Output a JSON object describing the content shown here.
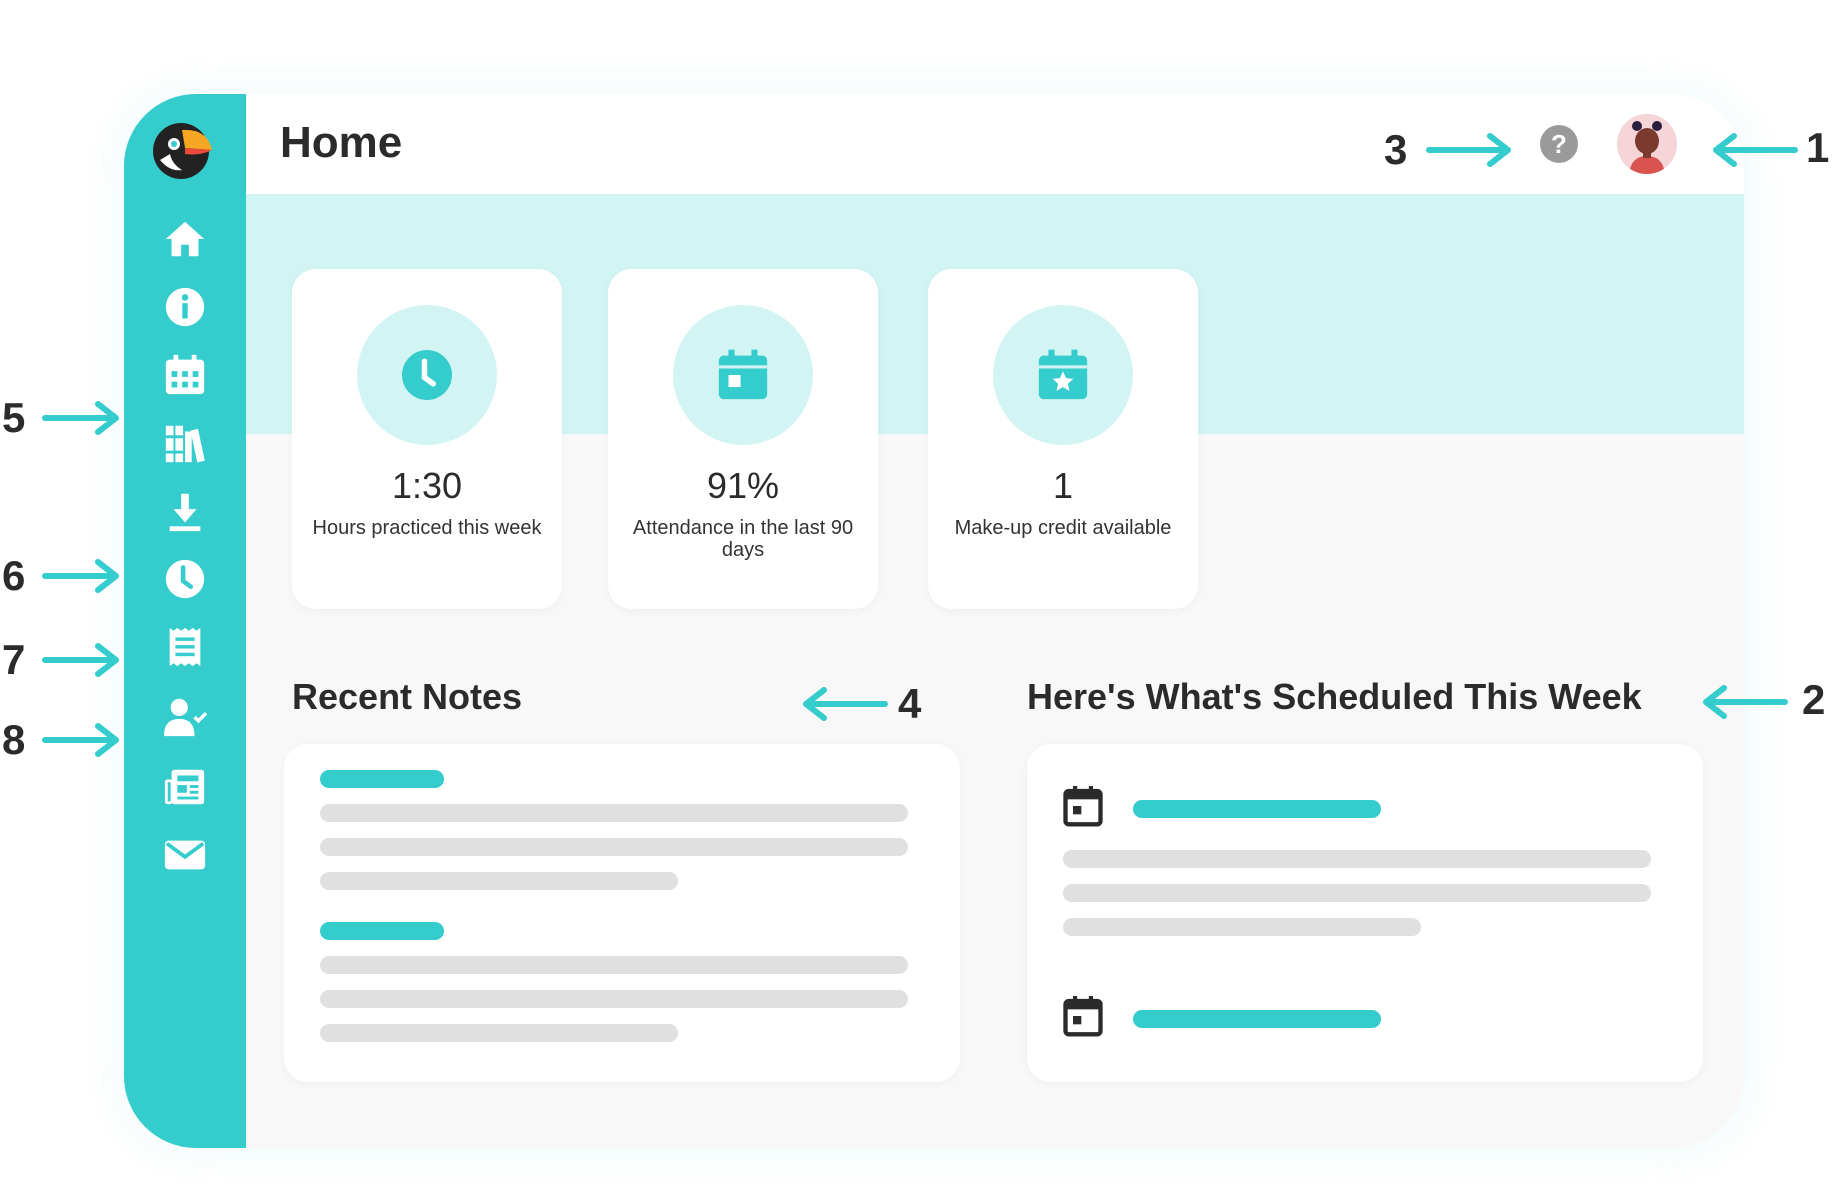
{
  "header": {
    "title": "Home",
    "help_glyph": "?"
  },
  "sidebar": {
    "logo": "toucan-logo",
    "items": [
      {
        "icon": "home-icon"
      },
      {
        "icon": "info-icon"
      },
      {
        "icon": "calendar-icon"
      },
      {
        "icon": "library-icon"
      },
      {
        "icon": "download-icon"
      },
      {
        "icon": "clock-icon"
      },
      {
        "icon": "receipt-icon"
      },
      {
        "icon": "user-check-icon"
      },
      {
        "icon": "newspaper-icon"
      },
      {
        "icon": "mail-icon"
      }
    ]
  },
  "stats": [
    {
      "value": "1:30",
      "label": "Hours practiced this week",
      "icon": "clock-icon"
    },
    {
      "value": "91%",
      "label": "Attendance in the last 90 days",
      "icon": "calendar-icon"
    },
    {
      "value": "1",
      "label": "Make-up credit available",
      "icon": "calendar-star-icon"
    }
  ],
  "sections": {
    "notes_title": "Recent Notes",
    "schedule_title": "Here's What's Scheduled This Week"
  },
  "annotations": [
    "1",
    "2",
    "3",
    "4",
    "5",
    "6",
    "7",
    "8"
  ],
  "colors": {
    "accent": "#34cccc",
    "accent_light": "#d2f5f4",
    "placeholder": "#e0e0e0"
  }
}
